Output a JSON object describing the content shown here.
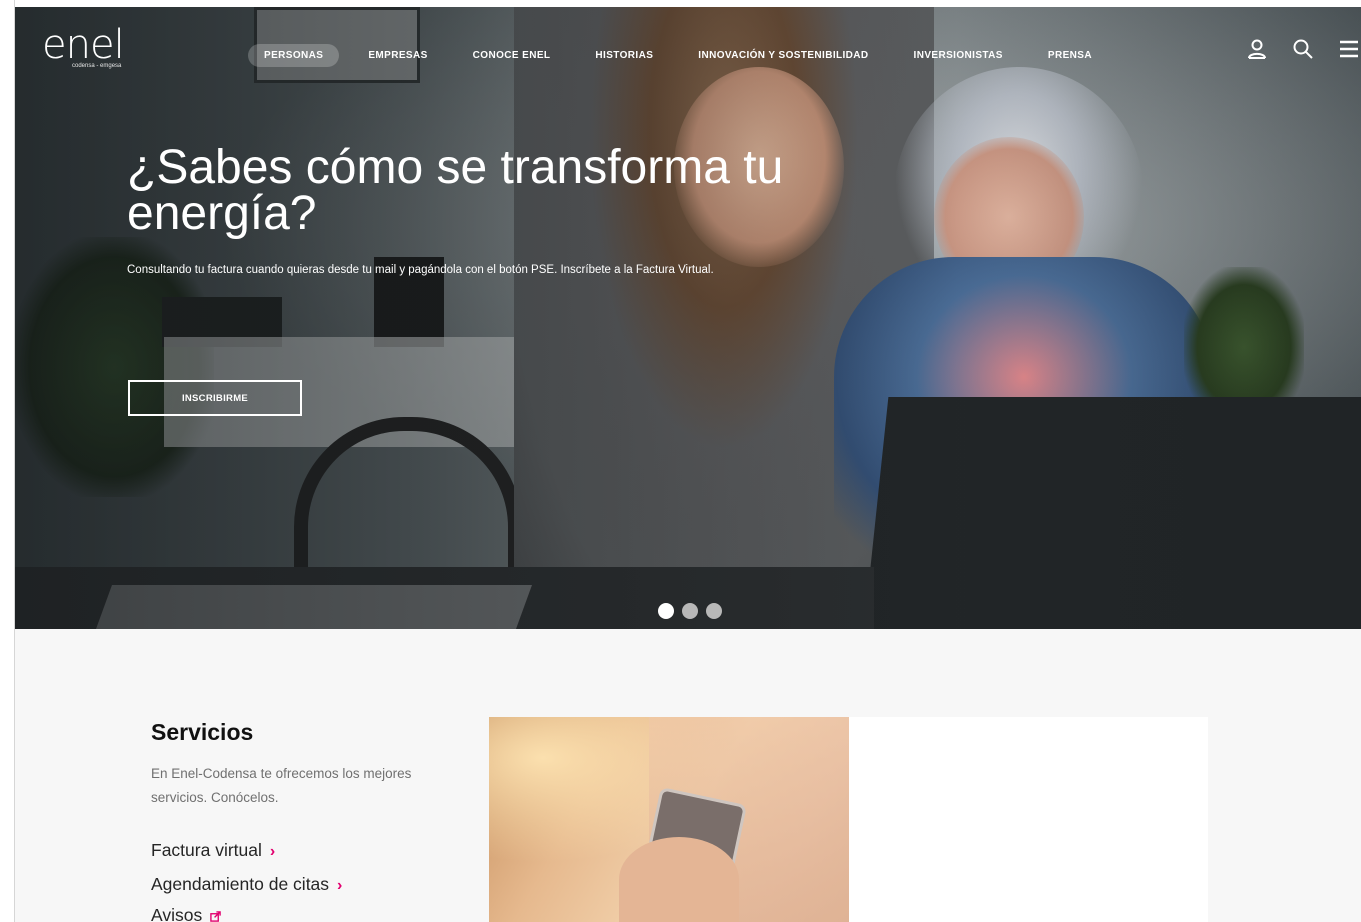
{
  "logo": {
    "word": "enel",
    "subtitle": "codensa - emgesa"
  },
  "nav": {
    "items": [
      {
        "label": "PERSONAS",
        "active": true
      },
      {
        "label": "EMPRESAS",
        "active": false
      },
      {
        "label": "CONOCE ENEL",
        "active": false
      },
      {
        "label": "HISTORIAS",
        "active": false
      },
      {
        "label": "INNOVACIÓN Y SOSTENIBILIDAD",
        "active": false
      },
      {
        "label": "INVERSIONISTAS",
        "active": false
      },
      {
        "label": "PRENSA",
        "active": false
      }
    ]
  },
  "header_icons": [
    "user-icon",
    "search-icon",
    "menu-icon"
  ],
  "hero": {
    "title": "¿Sabes cómo se transforma tu energía?",
    "subtitle": "Consultando tu factura cuando quieras desde tu mail y pagándola con el botón PSE. Inscríbete a la Factura Virtual.",
    "button_label": "INSCRIBIRME",
    "slides_total": 3,
    "active_slide": 1
  },
  "services": {
    "title": "Servicios",
    "description": "En Enel-Codensa te ofrecemos los mejores servicios. Conócelos.",
    "links": [
      {
        "label": "Factura virtual",
        "icon": "chevron-right-icon"
      },
      {
        "label": "Agendamiento de citas",
        "icon": "chevron-right-icon"
      },
      {
        "label": "Avisos",
        "icon": "external-link-icon"
      }
    ]
  },
  "colors": {
    "accent": "#e2006f",
    "section_bg": "#f7f7f7"
  }
}
